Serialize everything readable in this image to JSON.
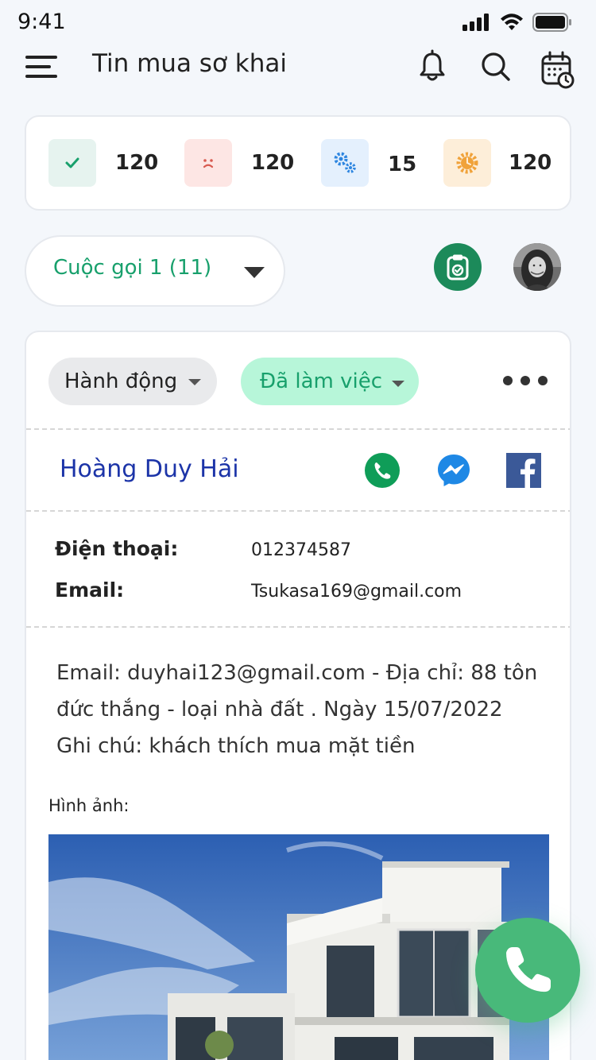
{
  "status_bar": {
    "time": "9:41"
  },
  "header": {
    "title": "Tin mua sơ khai"
  },
  "stats": [
    {
      "icon": "check-icon",
      "value": "120",
      "bg": "#e6f3ef",
      "color": "#18a06c"
    },
    {
      "icon": "sad-face-icon",
      "value": "120",
      "bg": "#fde6e4",
      "color": "#d85a50"
    },
    {
      "icon": "gears-icon",
      "value": "15",
      "bg": "#e4f0fd",
      "color": "#2e86e0"
    },
    {
      "icon": "sun-gear-icon",
      "value": "120",
      "bg": "#fdeed9",
      "color": "#f0a23a"
    }
  ],
  "call_select": {
    "label": "Cuộc gọi 1 (11)"
  },
  "record": {
    "action_label": "Hành động",
    "status_label": "Đã làm việc",
    "contact_name": "Hoàng Duy Hải",
    "phone_label": "Điện thoại:",
    "phone_value": "012374587",
    "email_label": "Email:",
    "email_value": "Tsukasa169@gmail.com",
    "note_lines": [
      "Email: duyhai123@gmail.com - Địa chỉ: 88 tôn",
      "đức thắng - loại nhà đất . Ngày 15/07/2022",
      "Ghi chú: khách thích mua mặt tiền"
    ],
    "images_label": "Hình ảnh:"
  },
  "colors": {
    "accent": "#18a06c",
    "name": "#1c34a8",
    "fab": "#48b97a",
    "status_pill": "#b7f6d9"
  }
}
